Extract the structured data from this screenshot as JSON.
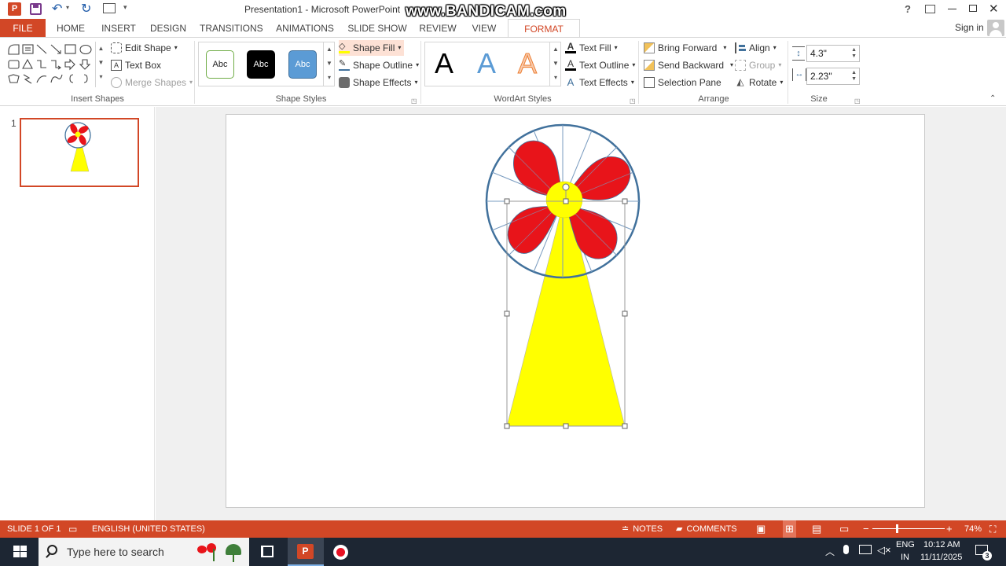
{
  "window": {
    "title": "Presentation1 - Microsoft PowerPoint",
    "watermark": "www.BANDICAM.com",
    "help": "?",
    "sign_in": "Sign in"
  },
  "tabs": [
    {
      "label": "FILE"
    },
    {
      "label": "HOME"
    },
    {
      "label": "INSERT"
    },
    {
      "label": "DESIGN"
    },
    {
      "label": "TRANSITIONS"
    },
    {
      "label": "ANIMATIONS"
    },
    {
      "label": "SLIDE SHOW"
    },
    {
      "label": "REVIEW"
    },
    {
      "label": "VIEW"
    },
    {
      "label": "FORMAT"
    }
  ],
  "ribbon": {
    "insert_shapes": {
      "label": "Insert Shapes",
      "edit_shape": "Edit Shape",
      "text_box": "Text Box",
      "merge_shapes": "Merge Shapes"
    },
    "shape_styles": {
      "label": "Shape Styles",
      "swatches": [
        "Abc",
        "Abc",
        "Abc"
      ],
      "shape_fill": "Shape Fill",
      "shape_outline": "Shape Outline",
      "shape_effects": "Shape Effects"
    },
    "wordart": {
      "label": "WordArt Styles",
      "letters": [
        "A",
        "A",
        "A"
      ],
      "text_fill": "Text Fill",
      "text_outline": "Text Outline",
      "text_effects": "Text Effects"
    },
    "arrange": {
      "label": "Arrange",
      "bring_forward": "Bring Forward",
      "send_backward": "Send Backward",
      "selection_pane": "Selection Pane",
      "align": "Align",
      "group": "Group",
      "rotate": "Rotate"
    },
    "size": {
      "label": "Size",
      "height": "4.3\"",
      "width": "2.23\""
    }
  },
  "thumbnails": {
    "number": "1"
  },
  "statusbar": {
    "slide": "SLIDE 1 OF 1",
    "language": "ENGLISH (UNITED STATES)",
    "notes": "NOTES",
    "comments": "COMMENTS",
    "zoom": "74%"
  },
  "taskbar": {
    "search_placeholder": "Type here to search",
    "lang": "ENG",
    "region": "IN",
    "time": "10:12 AM",
    "date": "11/11/2025",
    "notif_count": "3"
  },
  "colors": {
    "accent": "#d24726",
    "petal": "#e8141a",
    "fill_yellow": "#ffff00",
    "ring": "#41719c"
  }
}
